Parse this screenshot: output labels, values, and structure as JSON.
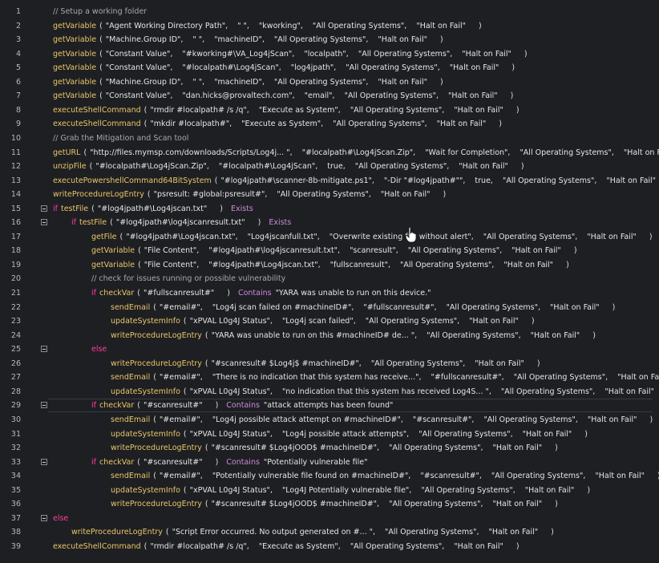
{
  "lines": [
    {
      "n": "1",
      "indent": 0,
      "comment": "//  Setup a working folder"
    },
    {
      "n": "2",
      "indent": 0,
      "fn": "getVariable",
      "args": [
        "\"Agent Working Directory Path\",",
        "\"  \",",
        "\"kworking\",",
        "\"All Operating Systems\",",
        "\"Halt on Fail\""
      ]
    },
    {
      "n": "3",
      "indent": 0,
      "fn": "getVariable",
      "args": [
        "\"Machine.Group ID\",",
        "\"  \",",
        "\"machineID\",",
        "\"All Operating Systems\",",
        "\"Halt on Fail\""
      ]
    },
    {
      "n": "4",
      "indent": 0,
      "fn": "getVariable",
      "args": [
        "\"Constant Value\",",
        "\"#kworking#\\VA_Log4jScan\",",
        "\"localpath\",",
        "\"All Operating Systems\",",
        "\"Halt on Fail\""
      ]
    },
    {
      "n": "5",
      "indent": 0,
      "fn": "getVariable",
      "args": [
        "\"Constant Value\",",
        "\"#localpath#\\Log4jScan\",",
        "\"log4jpath\",",
        "\"All Operating Systems\",",
        "\"Halt on Fail\""
      ]
    },
    {
      "n": "6",
      "indent": 0,
      "fn": "getVariable",
      "args": [
        "\"Machine.Group ID\",",
        "\"  \",",
        "\"machineID\",",
        "\"All Operating Systems\",",
        "\"Halt on Fail\""
      ]
    },
    {
      "n": "7",
      "indent": 0,
      "fn": "getVariable",
      "args": [
        "\"Constant Value\",",
        "\"dan.hicks@provaltech.com\",",
        "\"email\",",
        "\"All Operating Systems\",",
        "\"Halt on Fail\""
      ]
    },
    {
      "n": "8",
      "indent": 0,
      "fn": "executeShellCommand",
      "args": [
        "\"rmdir #localpath# /s /q\",",
        "\"Execute as System\",",
        "\"All Operating Systems\",",
        "\"Halt on Fail\""
      ]
    },
    {
      "n": "9",
      "indent": 0,
      "fn": "executeShellCommand",
      "args": [
        "\"mkdir #localpath#\",",
        "\"Execute as System\",",
        "\"All Operating Systems\",",
        "\"Halt on Fail\""
      ]
    },
    {
      "n": "10",
      "indent": 0,
      "comment": "//  Grab the Mitigation and Scan tool"
    },
    {
      "n": "11",
      "indent": 0,
      "fn": "getURL",
      "args": [
        "\"http://files.mymsp.com/downloads/Scripts/Log4j... \",",
        "\"#localpath#\\Log4jScan.Zip\",",
        "\"Wait for Completion\",",
        "\"All Operating Systems\",",
        "\"Halt on Fail\""
      ]
    },
    {
      "n": "12",
      "indent": 0,
      "fn": "unzipFile",
      "args": [
        "\"#localpath#\\Log4jScan.Zip\",",
        "\"#localpath#\\Log4jScan\",",
        "true,",
        "\"All Operating Systems\",",
        "\"Halt on Fail\""
      ]
    },
    {
      "n": "13",
      "indent": 0,
      "fn": "executePowershellCommand64BitSystem",
      "args": [
        "\"#log4jpath#\\scanner-8b-mitigate.ps1\",",
        "\"-Dir \"#log4jpath#\"\",",
        "true,",
        "\"All Operating Systems\",",
        "\"Halt on Fail\""
      ]
    },
    {
      "n": "14",
      "indent": 0,
      "fn": "writeProcedureLogEntry",
      "args": [
        "\"psresult: #global:psresult#\",",
        "\"All Operating Systems\",",
        "\"Halt on Fail\""
      ]
    },
    {
      "n": "15",
      "indent": 0,
      "fold": true,
      "kw": "if",
      "fn": "testFile",
      "args": [
        "\"#log4jpath#\\Log4jscan.txt\""
      ],
      "cond": "Exists"
    },
    {
      "n": "16",
      "indent": 1,
      "fold": true,
      "kw": "if",
      "fn": "testFile",
      "args": [
        "\"#log4jpath#\\log4jscanresult.txt\""
      ],
      "cond": "Exists"
    },
    {
      "n": "17",
      "indent": 2,
      "fn": "getFile",
      "args": [
        "\"#log4jpath#\\Log4jscan.txt\",",
        "\"Log4jscanfull.txt\",",
        "\"Overwrite existing file without alert\",",
        "\"All Operating Systems\",",
        "\"Halt on Fail\""
      ]
    },
    {
      "n": "18",
      "indent": 2,
      "fn": "getVariable",
      "args": [
        "\"File Content\",",
        "\"#log4jpath#\\log4jscanresult.txt\",",
        "\"scanresult\",",
        "\"All Operating Systems\",",
        "\"Halt on Fail\""
      ]
    },
    {
      "n": "19",
      "indent": 2,
      "fn": "getVariable",
      "args": [
        "\"File Content\",",
        "\"#log4jpath#\\Log4jscan.txt\",",
        "\"fullscanresult\",",
        "\"All Operating Systems\",",
        "\"Halt on Fail\""
      ]
    },
    {
      "n": "20",
      "indent": 2,
      "comment": "//  check for issues running or possible vulnerability"
    },
    {
      "n": "21",
      "indent": 2,
      "kw": "if",
      "fn": "checkVar",
      "args": [
        "\"#fullscanresult#\""
      ],
      "cond": "Contains",
      "tail": "\"YARA was unable to run on this device.\""
    },
    {
      "n": "22",
      "indent": 3,
      "fn": "sendEmail",
      "args": [
        "\"#email#\",",
        "\"Log4j scan failed on #machineID#\",",
        "\"#fullscanresult#\",",
        "\"All Operating Systems\",",
        "\"Halt on Fail\""
      ]
    },
    {
      "n": "23",
      "indent": 3,
      "fn": "updateSystemInfo",
      "args": [
        "\"xPVAL L0g4J Status\",",
        "\"Log4j scan failed\",",
        "\"All Operating Systems\",",
        "\"Halt on Fail\""
      ]
    },
    {
      "n": "24",
      "indent": 3,
      "fn": "writeProcedureLogEntry",
      "args": [
        "\"YARA was unable to run on this #machineID# de... \",",
        "\"All Operating Systems\",",
        "\"Halt on Fail\""
      ]
    },
    {
      "n": "25",
      "indent": 2,
      "fold": true,
      "kw": "else"
    },
    {
      "n": "26",
      "indent": 3,
      "fn": "writeProcedureLogEntry",
      "args": [
        "\"#scanresult# $Log4j$ #machineID#\",",
        "\"All Operating Systems\",",
        "\"Halt on Fail\""
      ]
    },
    {
      "n": "27",
      "indent": 3,
      "fn": "sendEmail",
      "args": [
        "\"#email#\",",
        "\"There is no indication that this system has receive...\",",
        "\"#fullscanresult#\",",
        "\"All Operating Systems\",",
        "\"Halt on Fail\""
      ]
    },
    {
      "n": "28",
      "indent": 3,
      "fn": "updateSystemInfo",
      "args": [
        "\"xPVAL L0g4J Status\",",
        "\"no indication that this system has received Log4S... \",",
        "\"All Operating Systems\",",
        "\"Halt on Fail\""
      ]
    },
    {
      "n": "29",
      "indent": 2,
      "fold": true,
      "active": true,
      "kw": "if",
      "fn": "checkVar",
      "args": [
        "\"#scanresult#\""
      ],
      "cond": "Contains",
      "tail": "\"attack attempts has been found\""
    },
    {
      "n": "30",
      "indent": 3,
      "fn": "sendEmail",
      "args": [
        "\"#email#\",",
        "\"Log4j possible attack attempt on #machineID#\",",
        "\"#scanresult#\",",
        "\"All Operating Systems\",",
        "\"Halt on Fail\""
      ]
    },
    {
      "n": "31",
      "indent": 3,
      "fn": "updateSystemInfo",
      "args": [
        "\"xPVAL L0g4J Status\",",
        "\"Log4j possible attack attempts\",",
        "\"All Operating Systems\",",
        "\"Halt on Fail\""
      ]
    },
    {
      "n": "32",
      "indent": 3,
      "fn": "writeProcedureLogEntry",
      "args": [
        "\"#scanresult# $Log4jOOD$ #machineID#\",",
        "\"All Operating Systems\",",
        "\"Halt on Fail\""
      ]
    },
    {
      "n": "33",
      "indent": 2,
      "fold": true,
      "kw": "if",
      "fn": "checkVar",
      "args": [
        "\"#scanresult#\""
      ],
      "cond": "Contains",
      "tail": "\"Potentially vulnerable file\""
    },
    {
      "n": "34",
      "indent": 3,
      "fn": "sendEmail",
      "args": [
        "\"#email#\",",
        "\"Potentially vulnerable file found on #machineID#\",",
        "\"#scanresult#\",",
        "\"All Operating Systems\",",
        "\"Halt on Fail\""
      ]
    },
    {
      "n": "35",
      "indent": 3,
      "fn": "updateSystemInfo",
      "args": [
        "\"xPVAL L0g4J Status\",",
        "\"Log4J Potentially vulnerable file\",",
        "\"All Operating Systems\",",
        "\"Halt on Fail\""
      ]
    },
    {
      "n": "36",
      "indent": 3,
      "fn": "writeProcedureLogEntry",
      "args": [
        "\"#scanresult# $Log4jOOD$ #machineID#\",",
        "\"All Operating Systems\",",
        "\"Halt on Fail\""
      ]
    },
    {
      "n": "37",
      "indent": 0,
      "fold": true,
      "kw": "else"
    },
    {
      "n": "38",
      "indent": 1,
      "fn": "writeProcedureLogEntry",
      "args": [
        "\"Script Error occurred. No output generated on #...   \",",
        "\"All Operating Systems\",",
        "\"Halt on Fail\""
      ]
    },
    {
      "n": "39",
      "indent": 0,
      "fn": "executeShellCommand",
      "args": [
        "\"rmdir #localpath# /s /q\",",
        "\"Execute as System\",",
        "\"All Operating Systems\",",
        "\"Halt on Fail\""
      ]
    }
  ]
}
